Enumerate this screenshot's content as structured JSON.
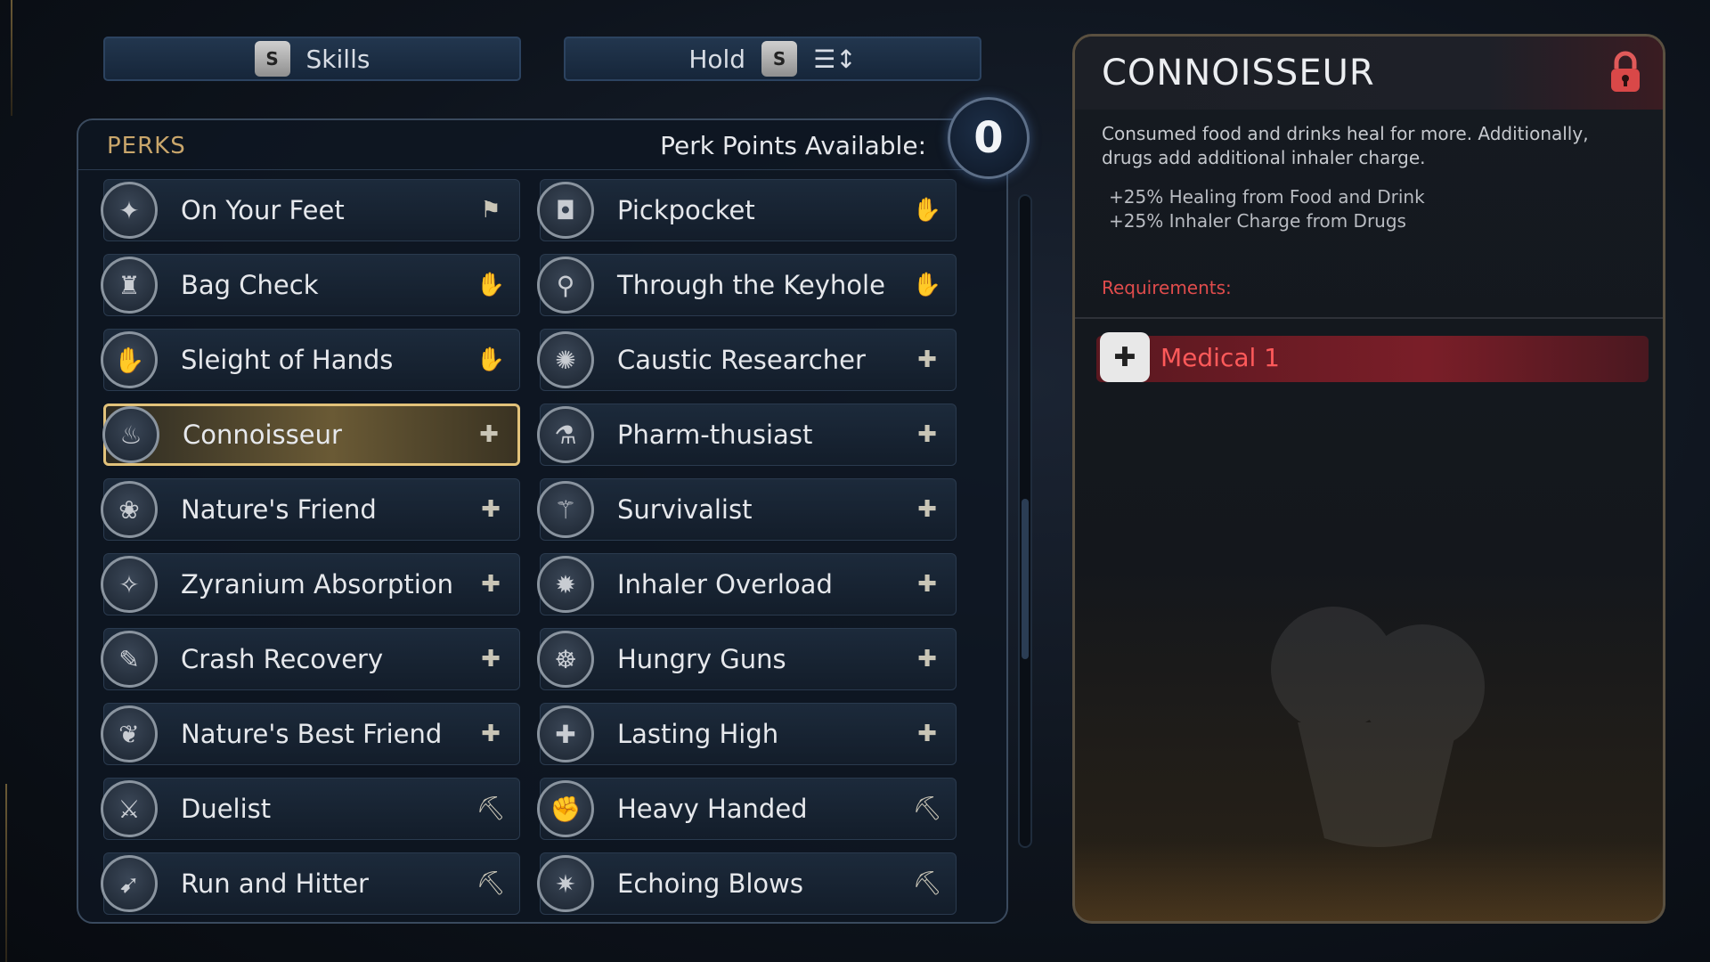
{
  "top_buttons": {
    "skills": {
      "key": "S",
      "label": "Skills"
    },
    "hold": {
      "label": "Hold",
      "key": "S",
      "icon": "sort-icon"
    }
  },
  "perks_panel": {
    "title": "PERKS",
    "points_label": "Perk Points Available:",
    "points_value": "0"
  },
  "perks": [
    {
      "name": "On Your Feet",
      "icon": "figure-icon",
      "category": "flag-icon",
      "selected": false
    },
    {
      "name": "Pickpocket",
      "icon": "pocket-icon",
      "category": "hand-icon",
      "selected": false
    },
    {
      "name": "Bag Check",
      "icon": "bag-icon",
      "category": "hand-icon",
      "selected": false
    },
    {
      "name": "Through the Keyhole",
      "icon": "keyhole-icon",
      "category": "hand-icon",
      "selected": false
    },
    {
      "name": "Sleight of Hands",
      "icon": "hands-icon",
      "category": "hand-icon",
      "selected": false
    },
    {
      "name": "Caustic Researcher",
      "icon": "splat-icon",
      "category": "medkit-icon",
      "selected": false
    },
    {
      "name": "Connoisseur",
      "icon": "chef-hat-icon",
      "category": "medkit-icon",
      "selected": true
    },
    {
      "name": "Pharm-thusiast",
      "icon": "bottles-icon",
      "category": "medkit-icon",
      "selected": false
    },
    {
      "name": "Nature's Friend",
      "icon": "flower-icon",
      "category": "medkit-icon",
      "selected": false
    },
    {
      "name": "Survivalist",
      "icon": "drumstick-icon",
      "category": "medkit-icon",
      "selected": false
    },
    {
      "name": "Zyranium Absorption",
      "icon": "crystal-icon",
      "category": "medkit-icon",
      "selected": false
    },
    {
      "name": "Inhaler Overload",
      "icon": "burst-icon",
      "category": "medkit-icon",
      "selected": false
    },
    {
      "name": "Crash Recovery",
      "icon": "pill-icon",
      "category": "medkit-icon",
      "selected": false
    },
    {
      "name": "Hungry Guns",
      "icon": "gun-food-icon",
      "category": "medkit-icon",
      "selected": false
    },
    {
      "name": "Nature's Best Friend",
      "icon": "leaf-icon",
      "category": "medkit-icon",
      "selected": false
    },
    {
      "name": "Lasting High",
      "icon": "cross-icon",
      "category": "medkit-icon",
      "selected": false
    },
    {
      "name": "Duelist",
      "icon": "swords-icon",
      "category": "pickaxe-icon",
      "selected": false
    },
    {
      "name": "Heavy Handed",
      "icon": "fists-icon",
      "category": "pickaxe-icon",
      "selected": false
    },
    {
      "name": "Run and Hitter",
      "icon": "runner-icon",
      "category": "pickaxe-icon",
      "selected": false
    },
    {
      "name": "Echoing Blows",
      "icon": "impact-icon",
      "category": "pickaxe-icon",
      "selected": false
    }
  ],
  "detail": {
    "title": "CONNOISSEUR",
    "description": "Consumed food and drinks heal for more. Additionally, drugs add additional inhaler charge.",
    "bonuses": [
      "+25% Healing from Food and Drink",
      "+25% Inhaler Charge from Drugs"
    ],
    "requirements_label": "Requirements:",
    "requirement": "Medical 1",
    "status_icon": "lock-icon"
  },
  "colors": {
    "accent_gold": "#e2c27a",
    "requirement_red": "#ff5a5a",
    "perks_title": "#c9a66b"
  }
}
